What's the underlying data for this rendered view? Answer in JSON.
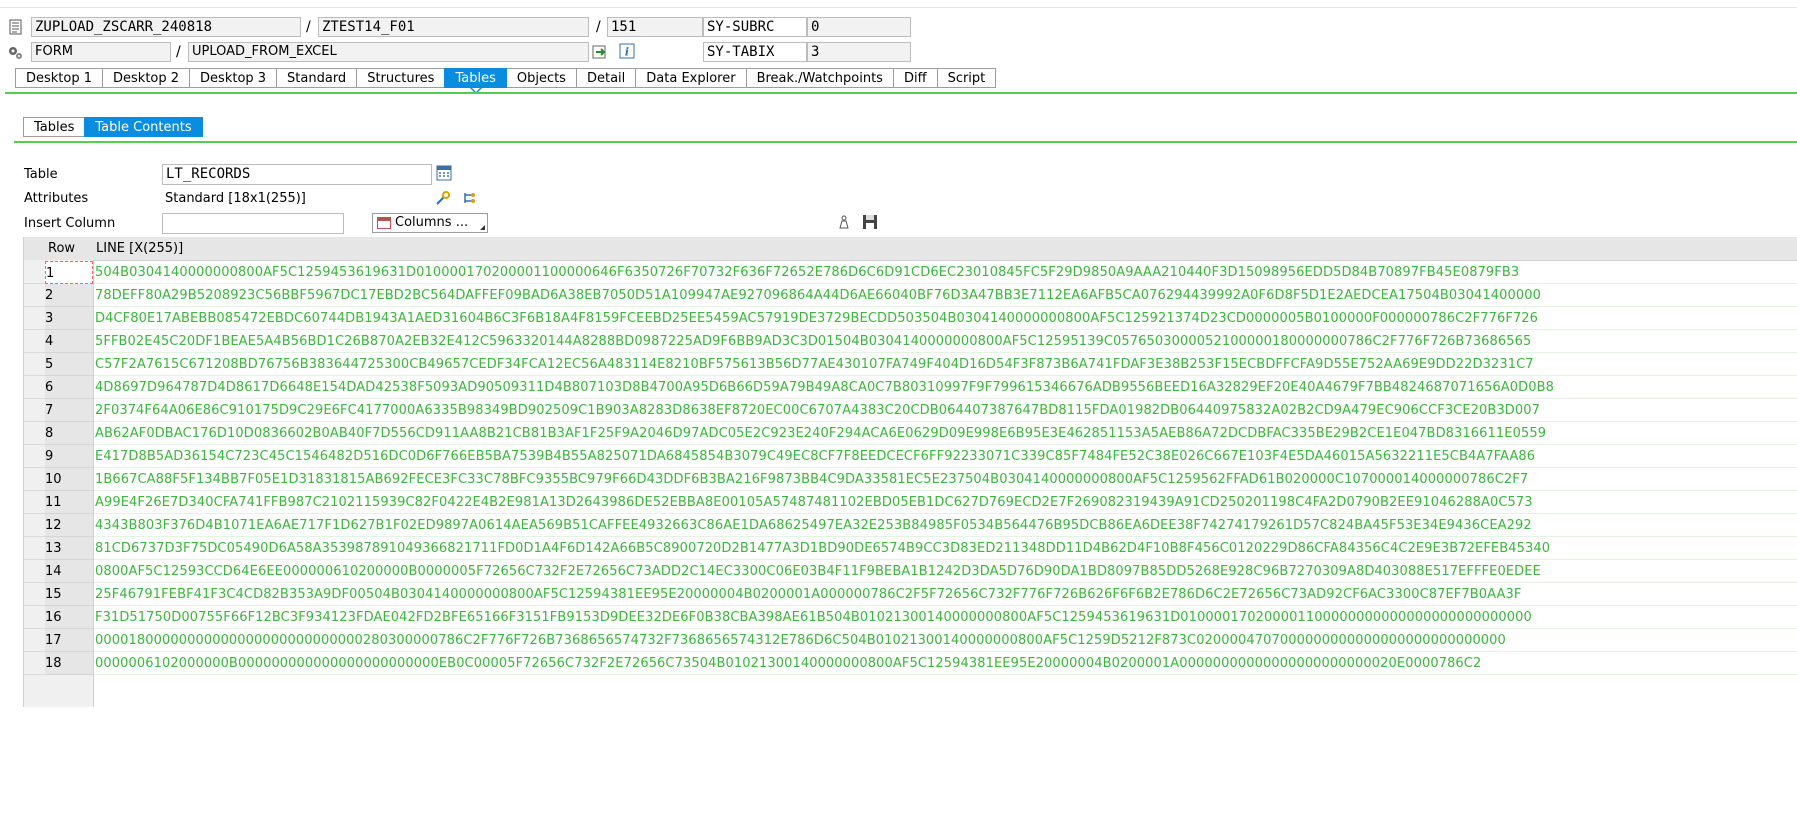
{
  "header": {
    "program": "ZUPLOAD_ZSCARR_240818",
    "include": "ZTEST14_F01",
    "line": "151",
    "sys1_name": "SY-SUBRC",
    "sys1_value": "0",
    "event_type": "FORM",
    "event_name": "UPLOAD_FROM_EXCEL",
    "sys2_name": "SY-TABIX",
    "sys2_value": "3",
    "sep": "/",
    "info_icon": "i"
  },
  "main_tabs": [
    "Desktop 1",
    "Desktop 2",
    "Desktop 3",
    "Standard",
    "Structures",
    "Tables",
    "Objects",
    "Detail",
    "Data Explorer",
    "Break./Watchpoints",
    "Diff",
    "Script"
  ],
  "active_main_tab": "Tables",
  "sub_tabs": [
    "Tables",
    "Table Contents"
  ],
  "active_sub_tab": "Table Contents",
  "form": {
    "table_label": "Table",
    "table_value": "LT_RECORDS",
    "attributes_label": "Attributes",
    "attributes_value": "Standard [18x1(255)]",
    "insert_column_label": "Insert Column",
    "insert_column_value": "",
    "columns_button": "Columns ..."
  },
  "grid": {
    "col_row": "Row",
    "col_line": "LINE [X(255)]",
    "rows": [
      {
        "row": "1",
        "line": "504B0304140000000800AF5C1259453619631D010000170200001100000646F6350726F70732F636F72652E786D6C6D91CD6EC23010845FC5F29D9850A9AAA210440F3D15098956EDD5D84B70897FB45E0879FB3"
      },
      {
        "row": "2",
        "line": "78DEFF80A29B5208923C56BBF5967DC17EBD2BC564DAFFEF09BAD6A38EB7050D51A109947AE927096864A44D6AE66040BF76D3A47BB3E7112EA6AFB5CA076294439992A0F6D8F5D1E2AEDCEA17504B03041400000"
      },
      {
        "row": "3",
        "line": "D4CF80E17ABEBB085472EBDC60744DB1943A1AED31604B6C3F6B18A4F8159FCEEBD25EE5459AC57919DE3729BECDD503504B0304140000000800AF5C125921374D23CD0000005B0100000F000000786C2F776F726"
      },
      {
        "row": "4",
        "line": "5FFB02E45C20DF1BEAE5A4B56BD1C26B870A2EB32E412C5963320144A8288BD0987225AD9F6BB9AD3C3D01504B0304140000000800AF5C12595139C0576503000052100000180000000786C2F776F726B73686565"
      },
      {
        "row": "5",
        "line": "C57F2A7615C671208BD76756B383644725300CB49657CEDF34FCA12EC56A483114E8210BF575613B56D77AE430107FA749F404D16D54F3F873B6A741FDAF3E38B253F15ECBDFFCFA9D55E752AA69E9DD22D3231C7"
      },
      {
        "row": "6",
        "line": "4D8697D964787D4D8617D6648E154DAD42538F5093AD90509311D4B807103D8B4700A95D6B66D59A79B49A8CA0C7B80310997F9F799615346676ADB9556BEED16A32829EF20E40A4679F7BB4824687071656A0D0B8"
      },
      {
        "row": "7",
        "line": "2F0374F64A06E86C910175D9C29E6FC4177000A6335B98349BD902509C1B903A8283D8638EF8720EC00C6707A4383C20CDB064407387647BD8115FDA01982DB06440975832A02B2CD9A479EC906CCF3CE20B3D007"
      },
      {
        "row": "8",
        "line": "AB62AF0DBAC176D10D0836602B0AB40F7D556CD911AA8B21CB81B3AF1F25F9A2046D97ADC05E2C923E240F294ACA6E0629D09E998E6B95E3E462851153A5AEB86A72DCDBFAC335BE29B2CE1E047BD8316611E0559"
      },
      {
        "row": "9",
        "line": "E417D8B5AD36154C723C45C1546482D516DC0D6F766EB5BA7539B4B55A825071DA6845854B3079C49EC8CF7F8EEDCECF6FF92233071C339C85F7484FE52C38E026C667E103F4E5DA46015A5632211E5CB4A7FAA86"
      },
      {
        "row": "10",
        "line": "1B667CA88F5F134BB7F05E1D31831815AB692FECE3FC33C78BFC9355BC979F66D43DDF6B3BA216F9873BB4C9DA33581EC5E237504B0304140000000800AF5C1259562FFAD61B020000C107000014000000786C2F7"
      },
      {
        "row": "11",
        "line": "A99E4F26E7D340CFA741FFB987C2102115939C82F0422E4B2E981A13D2643986DE52EBBA8E00105A57487481102EBD05EB1DC627D769ECD2E7F269082319439A91CD250201198C4FA2D0790B2EE91046288A0C573"
      },
      {
        "row": "12",
        "line": "4343B803F376D4B1071EA6AE717F1D627B1F02ED9897A0614AEA569B51CAFFEE4932663C86AE1DA68625497EA32E253B84985F0534B564476B95DCB86EA6DEE38F74274179261D57C824BA45F53E34E9436CEA292"
      },
      {
        "row": "13",
        "line": "81CD6737D3F75DC05490D6A58A353987891049366821711FD0D1A4F6D142A66B5C8900720D2B1477A3D1BD90DE6574B9CC3D83ED211348DD11D4B62D4F10B8F456C0120229D86CFA84356C4C2E9E3B72EFEB45340"
      },
      {
        "row": "14",
        "line": "0800AF5C12593CCD64E6EE000000610200000B0000005F72656C732F2E72656C73ADD2C14EC3300C06E03B4F11F9BEBA1B1242D3DA5D76D90DA1BD8097B85DD5268E928C96B7270309A8D403088E517EFFFE0EDEE"
      },
      {
        "row": "15",
        "line": "25F46791FEBF41F3C4CD82B353A9DF00504B0304140000000800AF5C12594381EE95E20000004B0200001A000000786C2F5F72656C732F776F726B626F6F6B2E786D6C2E72656C73AD92CF6AC3300C87EF7B0AA3F"
      },
      {
        "row": "16",
        "line": "F31D51750D00755F66F12BC3F934123FDAE042FD2BFE65166F3151FB9153D9DEE32DE6F0B38CBA398AE61B504B01021300140000000800AF5C1259453619631D010000170200001100000000000000000000000000"
      },
      {
        "row": "17",
        "line": "00001800000000000000000000000000280300000786C2F776F726B7368656574732F7368656574312E786D6C504B01021300140000000800AF5C1259D5212F873C0200004707000000000000000000000000000"
      },
      {
        "row": "18",
        "line": "0000006102000000B000000000000000000000000EB0C00005F72656C732F2E72656C73504B01021300140000000800AF5C12594381EE95E20000004B0200001A00000000000000000000000020E0000786C2"
      }
    ]
  }
}
